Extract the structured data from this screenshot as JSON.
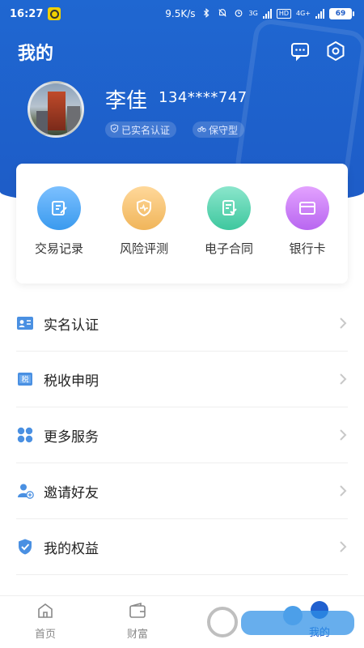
{
  "status_bar": {
    "time": "16:27",
    "network_speed": "9.5K/s",
    "signal1_tag": "3G",
    "hd_tag": "HD",
    "signal2_tag": "4G+",
    "battery": "69"
  },
  "header": {
    "title": "我的",
    "message_icon": "message-icon",
    "settings_icon": "settings-icon"
  },
  "profile": {
    "name": "李佳",
    "phone": "134****747",
    "tags": [
      "已实名认证",
      "保守型"
    ]
  },
  "quick_actions": [
    {
      "label": "交易记录",
      "icon": "edit-icon",
      "color": "#3a9aee"
    },
    {
      "label": "风险评测",
      "icon": "risk-shield-icon",
      "color": "#f0b55a"
    },
    {
      "label": "电子合同",
      "icon": "contract-icon",
      "color": "#3ec79e"
    },
    {
      "label": "银行卡",
      "icon": "bank-card-icon",
      "color": "#b866f0"
    }
  ],
  "menu": [
    {
      "label": "实名认证",
      "icon": "id-card-icon"
    },
    {
      "label": "税收申明",
      "icon": "tax-icon"
    },
    {
      "label": "更多服务",
      "icon": "grid-icon"
    },
    {
      "label": "邀请好友",
      "icon": "add-user-icon"
    },
    {
      "label": "我的权益",
      "icon": "shield-check-icon"
    }
  ],
  "tabbar": [
    {
      "label": "首页",
      "icon": "home-icon"
    },
    {
      "label": "财富",
      "icon": "wallet-icon"
    },
    {
      "label": "我的",
      "icon": "profile-icon",
      "active": true
    }
  ],
  "colors": {
    "primary": "#1e5cc7",
    "accent": "#2060cf"
  }
}
